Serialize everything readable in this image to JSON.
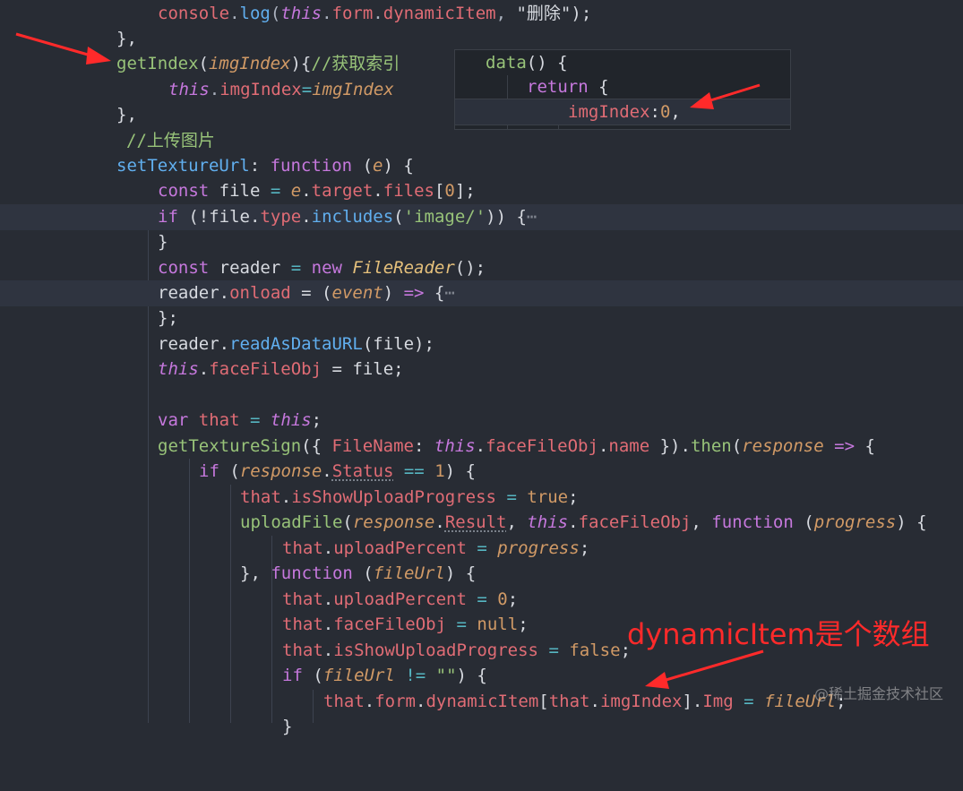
{
  "code": {
    "l1": {
      "a": "console",
      "b": ".",
      "c": "log",
      "d": "(",
      "e": "this",
      "f": ".",
      "g": "form",
      "h": ".",
      "i": "dynamicItem",
      "j": ", ",
      "k": "\"删除\"",
      "l": ");"
    },
    "l2": {
      "a": "},"
    },
    "l3": {
      "a": "getIndex",
      "b": "(",
      "c": "imgIndex",
      "d": "){",
      "e": "//获取索引"
    },
    "l4": {
      "a": "this",
      "b": ".",
      "c": "imgIndex",
      "d": "=",
      "e": "imgIndex"
    },
    "l5": {
      "a": "},"
    },
    "l6": {
      "a": "//上传图片"
    },
    "l7": {
      "a": "setTextureUrl",
      "b": ": ",
      "c": "function",
      "d": " (",
      "e": "e",
      "f": ") {"
    },
    "l8": {
      "a": "const",
      "b": " file ",
      "c": "=",
      "d": " ",
      "e": "e",
      "f": ".",
      "g": "target",
      "h": ".",
      "i": "files",
      "j": "[",
      "k": "0",
      "l": "];"
    },
    "l9": {
      "a": "if",
      "b": " (!",
      "c": "file",
      "d": ".",
      "e": "type",
      "f": ".",
      "g": "includes",
      "h": "(",
      "i": "'image/'",
      "j": ")) {",
      "k": "⋯"
    },
    "l10": {
      "a": "}"
    },
    "l11": {
      "a": "const",
      "b": " reader ",
      "c": "=",
      "d": " ",
      "e": "new",
      "f": " ",
      "g": "FileReader",
      "h": "();"
    },
    "l12": {
      "a": "reader",
      "b": ".",
      "c": "onload",
      "d": " = (",
      "e": "event",
      "f": ") ",
      "g": "=>",
      "h": " {",
      "i": "⋯"
    },
    "l13": {
      "a": "};"
    },
    "l14": {
      "a": "reader",
      "b": ".",
      "c": "readAsDataURL",
      "d": "(",
      "e": "file",
      "f": ");"
    },
    "l15": {
      "a": "this",
      "b": ".",
      "c": "faceFileObj",
      "d": " = ",
      "e": "file",
      "f": ";"
    },
    "l16": {
      "a": "var",
      "b": " that ",
      "c": "=",
      "d": " ",
      "e": "this",
      "f": ";"
    },
    "l17": {
      "a": "getTextureSign",
      "b": "({ ",
      "c": "FileName",
      "d": ": ",
      "e": "this",
      "f": ".",
      "g": "faceFileObj",
      "h": ".",
      "i": "name",
      "j": " }).",
      "k": "then",
      "l": "(",
      "m": "response",
      "n": " ",
      "o": "=>",
      "p": " {"
    },
    "l18": {
      "a": "if",
      "b": " (",
      "c": "response",
      "d": ".",
      "e": "Status",
      "f": " ",
      "g": "==",
      "h": " ",
      "i": "1",
      "j": ") {"
    },
    "l19": {
      "a": "that",
      "b": ".",
      "c": "isShowUploadProgress",
      "d": " ",
      "e": "=",
      "f": " ",
      "g": "true",
      "h": ";"
    },
    "l20": {
      "a": "uploadFile",
      "b": "(",
      "c": "response",
      "d": ".",
      "e": "Result",
      "f": ", ",
      "g": "this",
      "h": ".",
      "i": "faceFileObj",
      "j": ", ",
      "k": "function",
      "l": " (",
      "m": "progress",
      "n": ") {"
    },
    "l21": {
      "a": "that",
      "b": ".",
      "c": "uploadPercent",
      "d": " ",
      "e": "=",
      "f": " ",
      "g": "progress",
      "h": ";"
    },
    "l22": {
      "a": "}, ",
      "b": "function",
      "c": " (",
      "d": "fileUrl",
      "e": ") {"
    },
    "l23": {
      "a": "that",
      "b": ".",
      "c": "uploadPercent",
      "d": " ",
      "e": "=",
      "f": " ",
      "g": "0",
      "h": ";"
    },
    "l24": {
      "a": "that",
      "b": ".",
      "c": "faceFileObj",
      "d": " ",
      "e": "=",
      "f": " ",
      "g": "null",
      "h": ";"
    },
    "l25": {
      "a": "that",
      "b": ".",
      "c": "isShowUploadProgress",
      "d": " ",
      "e": "=",
      "f": " ",
      "g": "false",
      "h": ";"
    },
    "l26": {
      "a": "if",
      "b": " (",
      "c": "fileUrl",
      "d": " ",
      "e": "!=",
      "f": " ",
      "g": "\"\"",
      "h": ") {"
    },
    "l27": {
      "a": "that",
      "b": ".",
      "c": "form",
      "d": ".",
      "e": "dynamicItem",
      "f": "[",
      "g": "that",
      "h": ".",
      "i": "imgIndex",
      "j": "].",
      "k": "Img",
      "l": " ",
      "m": "=",
      "n": " ",
      "o": "fileUrl",
      "p": ";"
    },
    "l28": {
      "a": "}"
    }
  },
  "popup": {
    "l1": {
      "a": "data",
      "b": "() {"
    },
    "l2": {
      "a": "return",
      "b": " {"
    },
    "l3": {
      "a": "imgIndex",
      "b": ":",
      "c": "0",
      "d": ","
    }
  },
  "annotation": "dynamicItem是个数组",
  "watermark": "@稀土掘金技术社区",
  "colors": {
    "background": "#282c34",
    "arrow": "#ff2a2a"
  }
}
